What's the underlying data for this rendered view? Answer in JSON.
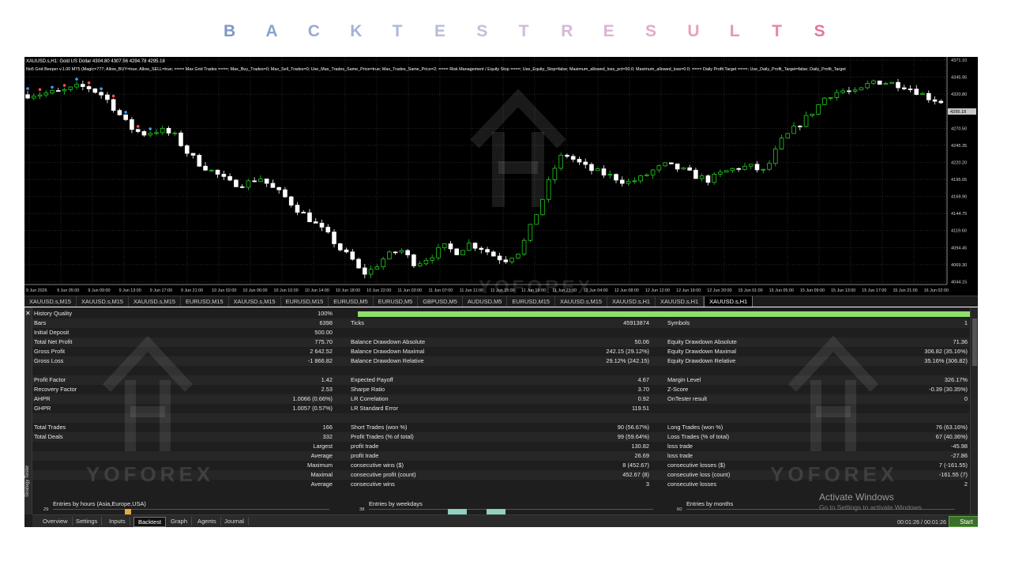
{
  "banner": {
    "letters": [
      {
        "ch": "B",
        "color": "#7f97c6"
      },
      {
        "ch": "A",
        "color": "#8aa2cf"
      },
      {
        "ch": "C",
        "color": "#98aad2"
      },
      {
        "ch": "K",
        "color": "#a3b2d5"
      },
      {
        "ch": "T",
        "color": "#adb7d8"
      },
      {
        "ch": "E",
        "color": "#b7bcdb"
      },
      {
        "ch": "S",
        "color": "#c4bddc"
      },
      {
        "ch": "T",
        "color": "#cdbcd9"
      },
      {
        "ch": "R",
        "color": "#d6b8d6"
      },
      {
        "ch": "E",
        "color": "#ddb4d2"
      },
      {
        "ch": "S",
        "color": "#e2acc9"
      },
      {
        "ch": "U",
        "color": "#e5a3bf"
      },
      {
        "ch": "L",
        "color": "#e597b2"
      },
      {
        "ch": "T",
        "color": "#e48aa5"
      },
      {
        "ch": "S",
        "color": "#e37898"
      }
    ]
  },
  "chart": {
    "header": "XAUUSD.s,H1: Gold US Dollar 4304.80 4307.56 4294.78 4295.18",
    "params": "No5 Grid Beeper v.1.00 MT5 (Magic=777; Allow_BUY=true; Allow_SELL=true; ==== Max Grid Trades ====; Max_Buy_Trades=0; Max_Sell_Trades=0; Use_Max_Trades_Same_Price=true; Max_Trades_Same_Price=2; ==== Risk Management / Equity Stop ====; Use_Equity_Stop=false; Maximum_allowed_loss_pct=50.0; Maximum_allowed_loss=0.0; ==== Daily Profit Target ====; Use_Daily_Profit_Target=false; Daily_Profit_Target",
    "watermark": "YOFOREX",
    "current_price": "4295.18",
    "price_labels": [
      "4371.10",
      "4345.95",
      "4320.80",
      "4270.50",
      "4245.35",
      "4220.20",
      "4195.05",
      "4169.90",
      "4144.75",
      "4119.60",
      "4094.45",
      "4069.30",
      "4044.15"
    ],
    "time_labels": [
      "9 Jun 2026",
      "9 Jun 05:00",
      "9 Jun 09:00",
      "9 Jun 13:00",
      "9 Jun 17:00",
      "9 Jun 21:00",
      "10 Jun 02:00",
      "10 Jun 06:00",
      "10 Jun 10:00",
      "10 Jun 14:00",
      "10 Jun 18:00",
      "10 Jun 22:00",
      "11 Jun 03:00",
      "11 Jun 07:00",
      "11 Jun 11:00",
      "11 Jun 15:00",
      "11 Jun 19:00",
      "11 Jun 23:00",
      "12 Jun 04:00",
      "12 Jun 08:00",
      "12 Jun 12:00",
      "12 Jun 16:00",
      "12 Jun 20:00",
      "15 Jun 01:00",
      "15 Jun 05:00",
      "15 Jun 09:00",
      "15 Jun 13:00",
      "15 Jun 17:00",
      "15 Jun 21:00",
      "16 Jun 02:00"
    ],
    "bull_color": "#22cc22",
    "bear_color": "#ffffff"
  },
  "chart_tabs": [
    "XAUUSD.s,M15",
    "XAUUSD.s,M15",
    "XAUUSD.s,M15",
    "EURUSD,M15",
    "XAUUSD.s,M15",
    "EURUSD,M15",
    "EURUSD,M5",
    "EURUSD,M5",
    "GBPUSD,M5",
    "AUDUSD,M5",
    "EURUSD,M15",
    "XAUUSD.s,M15",
    "XAUUSD.s,H1",
    "XAUUSD.s,H1",
    "XAUUSD.s,H1"
  ],
  "tester": {
    "side_label": "Strategy Tester",
    "rows": [
      {
        "c1l": "History Quality",
        "c1v": "100%",
        "bar": true
      },
      {
        "c1l": "Bars",
        "c1v": "6398",
        "c2l": "Ticks",
        "c2v": "45913874",
        "c3l": "Symbols",
        "c3v": "1"
      },
      {
        "c1l": "Initial Deposit",
        "c1v": "500.00"
      },
      {
        "c1l": "Total Net Profit",
        "c1v": "775.70",
        "c2l": "Balance Drawdown Absolute",
        "c2v": "50.06",
        "c3l": "Equity Drawdown Absolute",
        "c3v": "71.36"
      },
      {
        "c1l": "Gross Profit",
        "c1v": "2 642.52",
        "c2l": "Balance Drawdown Maximal",
        "c2v": "242.15 (29.12%)",
        "c3l": "Equity Drawdown Maximal",
        "c3v": "306.82 (35.16%)"
      },
      {
        "c1l": "Gross Loss",
        "c1v": "-1 866.82",
        "c2l": "Balance Drawdown Relative",
        "c2v": "29.12% (242.15)",
        "c3l": "Equity Drawdown Relative",
        "c3v": "35.16% (306.82)"
      },
      {},
      {
        "c1l": "Profit Factor",
        "c1v": "1.42",
        "c2l": "Expected Payoff",
        "c2v": "4.67",
        "c3l": "Margin Level",
        "c3v": "326.17%"
      },
      {
        "c1l": "Recovery Factor",
        "c1v": "2.53",
        "c2l": "Sharpe Ratio",
        "c2v": "3.70",
        "c3l": "Z-Score",
        "c3v": "-0.39 (30.35%)"
      },
      {
        "c1l": "AHPR",
        "c1v": "1.0066 (0.66%)",
        "c2l": "LR Correlation",
        "c2v": "0.92",
        "c3l": "OnTester result",
        "c3v": "0"
      },
      {
        "c1l": "GHPR",
        "c1v": "1.0057 (0.57%)",
        "c2l": "LR Standard Error",
        "c2v": "119.51"
      },
      {},
      {
        "c1l": "Total Trades",
        "c1v": "166",
        "c2l": "Short Trades (won %)",
        "c2v": "90 (56.67%)",
        "c3l": "Long Trades (won %)",
        "c3v": "76 (63.16%)"
      },
      {
        "c1l": "Total Deals",
        "c1v": "332",
        "c2l": "Profit Trades (% of total)",
        "c2v": "99 (59.64%)",
        "c3l": "Loss Trades (% of total)",
        "c3v": "67 (40.36%)"
      },
      {
        "c1v": "Largest",
        "c2l": "profit trade",
        "c2v": "130.82",
        "c3l": "loss trade",
        "c3v": "-45.98"
      },
      {
        "c1v": "Average",
        "c2l": "profit trade",
        "c2v": "26.69",
        "c3l": "loss trade",
        "c3v": "-27.86"
      },
      {
        "c1v": "Maximum",
        "c2l": "consecutive wins ($)",
        "c2v": "8 (452.67)",
        "c3l": "consecutive losses ($)",
        "c3v": "7 (-161.55)"
      },
      {
        "c1v": "Maximal",
        "c2l": "consecutive profit (count)",
        "c2v": "452.67 (8)",
        "c3l": "consecutive loss (count)",
        "c3v": "-161.55 (7)"
      },
      {
        "c1v": "Average",
        "c2l": "consecutive wins",
        "c2v": "3",
        "c3l": "consecutive losses",
        "c3v": "2"
      }
    ],
    "mini_charts": [
      {
        "label": "Entries by hours (Asia,Europe,USA)",
        "num": "29"
      },
      {
        "label": "Entries by weekdays",
        "num": "38"
      },
      {
        "label": "Entries by months",
        "num": "60"
      }
    ],
    "watermark": "YOFOREX",
    "activate_title": "Activate Windows",
    "activate_sub": "Go to Settings to activate Windows.",
    "bottom_tabs": [
      "Overview",
      "Settings",
      "Inputs",
      "Backtest",
      "Graph",
      "Agents",
      "Journal"
    ],
    "active_tab": "Backtest",
    "timer": "00:01:26 / 00:01:26",
    "start_label": "Start",
    "quality_bar_color": "#8ee06a"
  }
}
